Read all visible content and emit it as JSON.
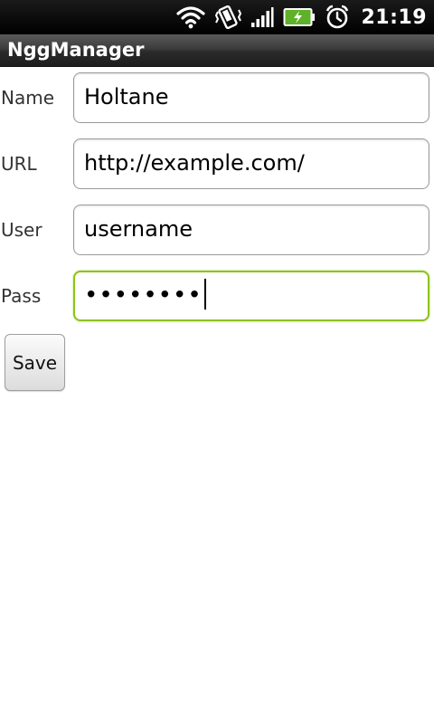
{
  "status_bar": {
    "time": "21:19",
    "icons": [
      "wifi-icon",
      "vibrate-icon",
      "signal-icon",
      "battery-charging-icon",
      "alarm-icon"
    ]
  },
  "app": {
    "title": "NggManager"
  },
  "form": {
    "name": {
      "label": "Name",
      "value": "Holtane"
    },
    "url": {
      "label": "URL",
      "value": "http://example.com/"
    },
    "user": {
      "label": "User",
      "value": "username"
    },
    "pass": {
      "label": "Pass",
      "value": "••••••••"
    }
  },
  "actions": {
    "save_label": "Save"
  },
  "colors": {
    "focus_border": "#8cc31f",
    "status_bar_bg": "#000000",
    "battery_fill": "#5fb12a"
  }
}
